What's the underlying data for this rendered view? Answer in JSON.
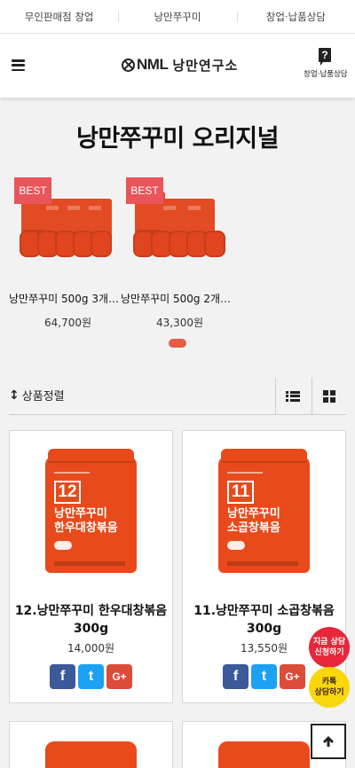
{
  "topnav": {
    "items": [
      "무인판매점 창업",
      "낭만쭈꾸미",
      "창업·납품상담"
    ]
  },
  "header": {
    "logo_en": "NML",
    "logo_ko": "낭만연구소",
    "consult_label": "창업·납품상담"
  },
  "section": {
    "title": "낭만쭈꾸미 오리지널"
  },
  "carousel": {
    "items": [
      {
        "badge": "BEST",
        "name": "낭만쭈꾸미 500g 3개…",
        "price": "64,700원"
      },
      {
        "badge": "BEST",
        "name": "낭만쭈꾸미 500g 2개…",
        "price": "43,300원"
      }
    ]
  },
  "sortbar": {
    "sort_label": "상품정렬"
  },
  "products": [
    {
      "number": "12",
      "pouch_title_1": "낭만쭈꾸미",
      "pouch_title_2": "한우대창볶음",
      "name_line1": "12.낭만쭈꾸미 한우대창볶음",
      "name_line2": "300g",
      "price": "14,000원"
    },
    {
      "number": "11",
      "pouch_title_1": "낭만쭈꾸미",
      "pouch_title_2": "소곱창볶음",
      "name_line1": "11.낭만쭈꾸미 소곱창볶음",
      "name_line2": "300g",
      "price": "13,550원"
    }
  ],
  "share": {
    "facebook": "f",
    "twitter": "t",
    "googleplus": "G+"
  },
  "floating": {
    "apply_line1": "지금 상담",
    "apply_line2": "신청하기",
    "kakao_line1": "카톡",
    "kakao_line2": "상담하기"
  },
  "colors": {
    "accent": "#e55c46",
    "best_badge": "#e9555b",
    "pouch": "#e84a1b",
    "facebook": "#3c5a99",
    "twitter": "#1da1f2",
    "googleplus": "#dd4b39",
    "apply": "#e8273a",
    "kakao": "#f8d80c"
  }
}
